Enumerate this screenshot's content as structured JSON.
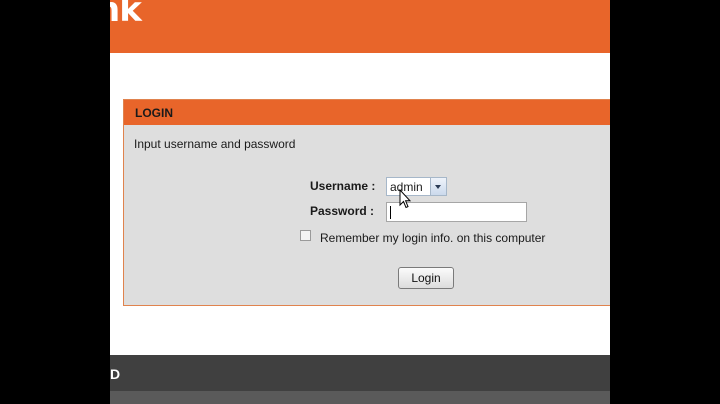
{
  "header": {
    "logo_text": "nk"
  },
  "login_panel": {
    "title": "LOGIN",
    "instruction": "Input username and password",
    "username_label": "Username :",
    "username_value": "admin",
    "password_label": "Password :",
    "password_value": "",
    "remember_label": "Remember my login info. on this computer",
    "remember_checked": false,
    "login_button": "Login"
  },
  "footer": {
    "text": "D"
  },
  "colors": {
    "accent": "#e8652a",
    "panel_bg": "#dedede",
    "footer_bg": "#404040"
  }
}
